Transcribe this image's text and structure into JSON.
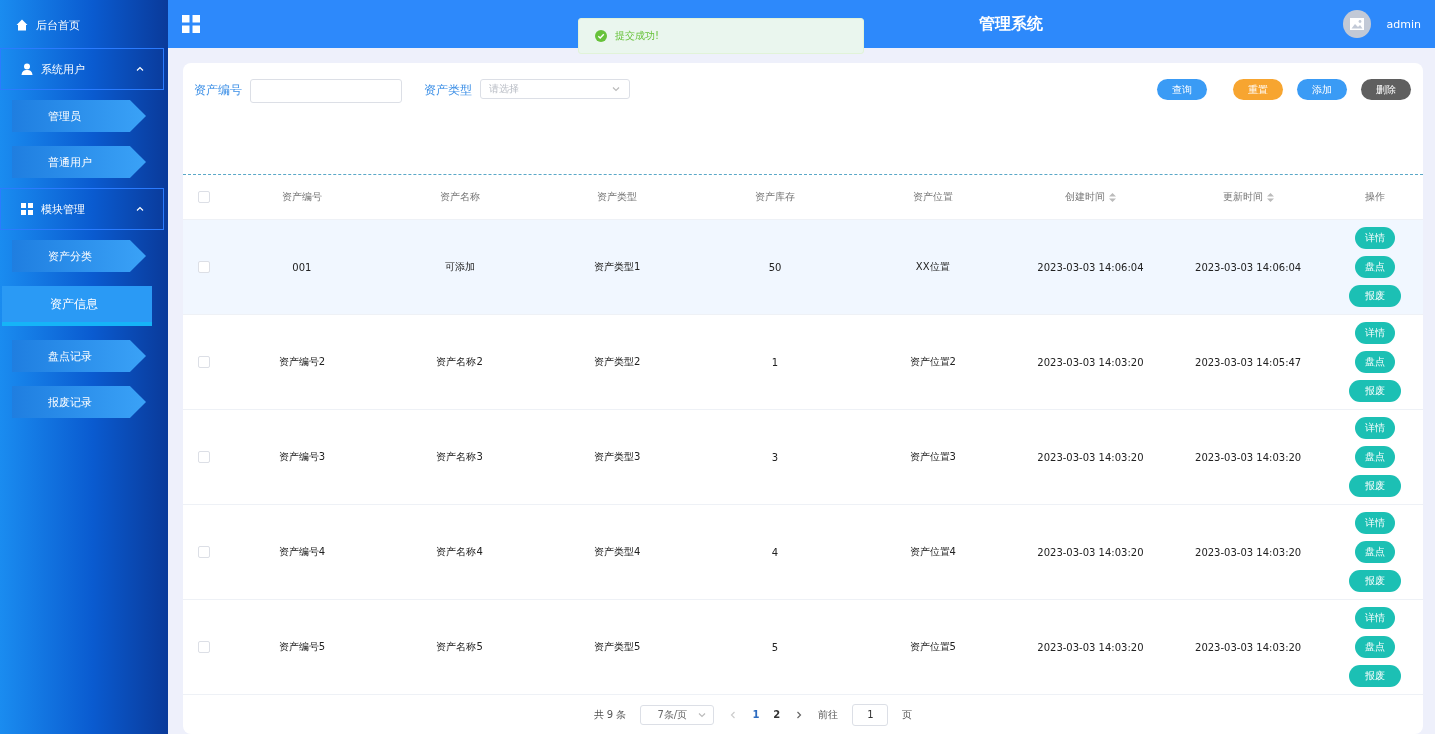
{
  "sidebar": {
    "home": {
      "label": "后台首页"
    },
    "groups": [
      {
        "label": "系统用户",
        "expanded": true,
        "children": [
          {
            "label": "管理员",
            "selected": false
          },
          {
            "label": "普通用户",
            "selected": false
          }
        ]
      },
      {
        "label": "模块管理",
        "expanded": true,
        "children": [
          {
            "label": "资产分类",
            "selected": false
          },
          {
            "label": "资产信息",
            "selected": true
          },
          {
            "label": "盘点记录",
            "selected": false
          },
          {
            "label": "报废记录",
            "selected": false
          }
        ]
      }
    ]
  },
  "header": {
    "title": "管理系统",
    "user": "admin"
  },
  "toast": {
    "message": "提交成功!"
  },
  "search": {
    "fields": [
      {
        "kind": "input",
        "label": "资产编号"
      },
      {
        "kind": "select",
        "label": "资产类型",
        "placeholder": "请选择"
      }
    ],
    "buttons": [
      {
        "label": "查询",
        "color": "#3a9bf5"
      },
      {
        "label": "重置",
        "color": "#f7a530"
      },
      {
        "label": "添加",
        "color": "#3a9bf5"
      },
      {
        "label": "删除",
        "color": "#5f5f5f"
      }
    ]
  },
  "table": {
    "columns": [
      {
        "label": "资产编号",
        "sortable": false
      },
      {
        "label": "资产名称",
        "sortable": false
      },
      {
        "label": "资产类型",
        "sortable": false
      },
      {
        "label": "资产库存",
        "sortable": false
      },
      {
        "label": "资产位置",
        "sortable": false
      },
      {
        "label": "创建时间",
        "sortable": true
      },
      {
        "label": "更新时间",
        "sortable": true
      },
      {
        "label": "操作",
        "sortable": false
      }
    ],
    "all_selected": false,
    "rows": [
      {
        "selected": false,
        "hovered": true,
        "cells": [
          "001",
          "可添加",
          "资产类型1",
          "50",
          "XX位置",
          "2023-03-03 14:06:04",
          "2023-03-03 14:06:04"
        ],
        "actions": [
          "详情",
          "盘点",
          "报废"
        ]
      },
      {
        "selected": false,
        "hovered": false,
        "cells": [
          "资产编号2",
          "资产名称2",
          "资产类型2",
          "1",
          "资产位置2",
          "2023-03-03 14:03:20",
          "2023-03-03 14:05:47"
        ],
        "actions": [
          "详情",
          "盘点",
          "报废"
        ]
      },
      {
        "selected": false,
        "hovered": false,
        "cells": [
          "资产编号3",
          "资产名称3",
          "资产类型3",
          "3",
          "资产位置3",
          "2023-03-03 14:03:20",
          "2023-03-03 14:03:20"
        ],
        "actions": [
          "详情",
          "盘点",
          "报废"
        ]
      },
      {
        "selected": false,
        "hovered": false,
        "cells": [
          "资产编号4",
          "资产名称4",
          "资产类型4",
          "4",
          "资产位置4",
          "2023-03-03 14:03:20",
          "2023-03-03 14:03:20"
        ],
        "actions": [
          "详情",
          "盘点",
          "报废"
        ]
      },
      {
        "selected": false,
        "hovered": false,
        "cells": [
          "资产编号5",
          "资产名称5",
          "资产类型5",
          "5",
          "资产位置5",
          "2023-03-03 14:03:20",
          "2023-03-03 14:03:20"
        ],
        "actions": [
          "详情",
          "盘点",
          "报废"
        ]
      }
    ]
  },
  "pagination": {
    "total": "共 9 条",
    "page_size": "7条/页",
    "pages": [
      {
        "label": "1",
        "selected": true
      },
      {
        "label": "2",
        "selected": false
      }
    ],
    "goto_label": "前往",
    "goto_value": "1",
    "goto_suffix": "页"
  }
}
